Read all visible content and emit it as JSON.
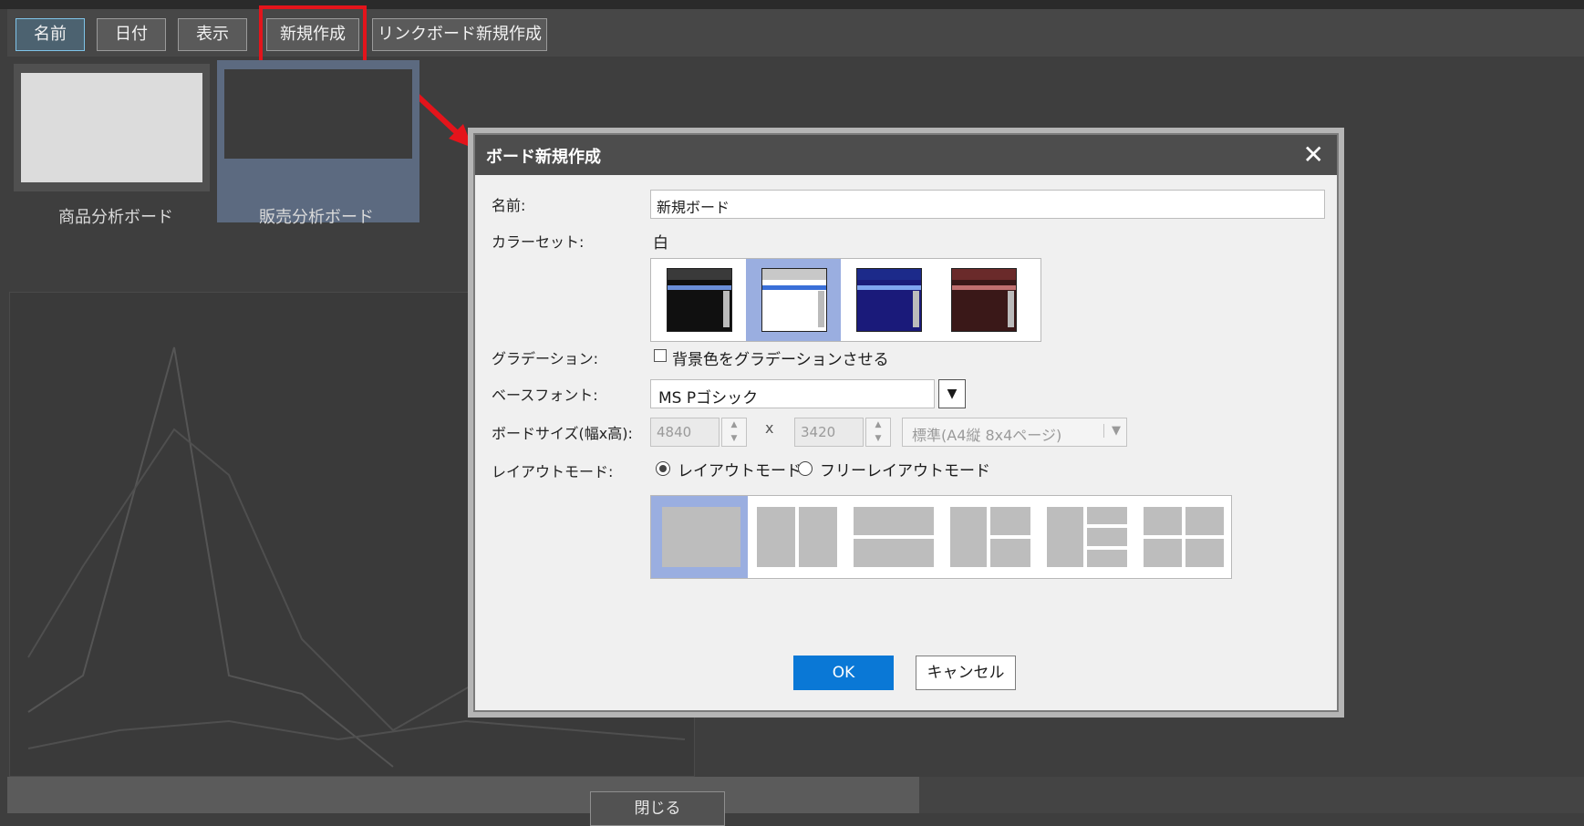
{
  "toolbar": {
    "name_label": "名前",
    "date_label": "日付",
    "display_label": "表示",
    "new_label": "新規作成",
    "link_new_label": "リンクボード新規作成"
  },
  "boards": [
    {
      "label": "商品分析ボード"
    },
    {
      "label": "販売分析ボード"
    }
  ],
  "background": {
    "close_label": "閉じる"
  },
  "dialog": {
    "title": "ボード新規作成",
    "close_symbol": "✕",
    "name_label": "名前:",
    "name_value": "新規ボード",
    "colorset_label": "カラーセット:",
    "colorset_value": "白",
    "colorsets": [
      {
        "name": "black",
        "top": "#3a3a3a",
        "body": "#101010",
        "line": "#6a8ed8"
      },
      {
        "name": "white",
        "top": "#c8c8c8",
        "body": "#ffffff",
        "line": "#3a6fd8"
      },
      {
        "name": "navy",
        "top": "#1c2a8a",
        "body": "#1a1a7a",
        "line": "#7fa4f0"
      },
      {
        "name": "maroon",
        "top": "#6a2a2a",
        "body": "#3a1818",
        "line": "#c07070"
      }
    ],
    "gradation_label": "グラデーション:",
    "gradation_checkbox_label": "背景色をグラデーションさせる",
    "basefont_label": "ベースフォント:",
    "basefont_value": "MS Pゴシック",
    "boardsize_label": "ボードサイズ(幅x高):",
    "width_value": "4840",
    "times_symbol": "x",
    "height_value": "3420",
    "size_preset": "標準(A4縦 8x4ページ)",
    "layoutmode_label": "レイアウトモード:",
    "layout_radio_label": "レイアウトモード",
    "free_layout_radio_label": "フリーレイアウトモード",
    "ok_label": "OK",
    "cancel_label": "キャンセル",
    "accent_color": "#0a78d6"
  }
}
